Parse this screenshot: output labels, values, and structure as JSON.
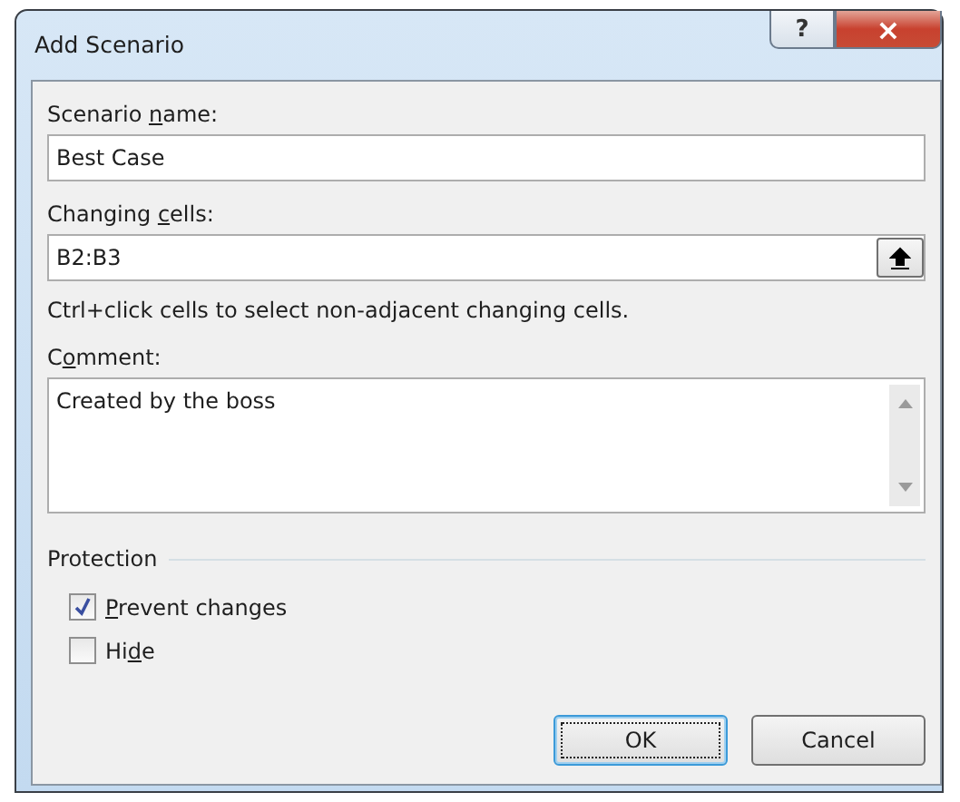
{
  "window": {
    "title": "Add Scenario",
    "help_button": "?",
    "close_button": "×"
  },
  "scenario_name": {
    "label": {
      "before": "Scenario ",
      "key": "n",
      "after": "ame:"
    },
    "value": "Best Case"
  },
  "changing_cells": {
    "label": {
      "before": "Changing ",
      "key": "c",
      "after": "ells:"
    },
    "value": "B2:B3",
    "hint": "Ctrl+click cells to select non-adjacent changing cells."
  },
  "comment": {
    "label": {
      "before": "C",
      "key": "o",
      "after": "mment:"
    },
    "value": "Created by the boss"
  },
  "protection": {
    "title": "Protection",
    "options": [
      {
        "label": {
          "key": "P",
          "after": "revent changes"
        },
        "checked": true
      },
      {
        "label": {
          "before": "Hi",
          "key": "d",
          "after": "e"
        },
        "checked": false
      }
    ]
  },
  "buttons": [
    {
      "label": "OK",
      "default": true
    },
    {
      "label": "Cancel",
      "default": false
    }
  ]
}
